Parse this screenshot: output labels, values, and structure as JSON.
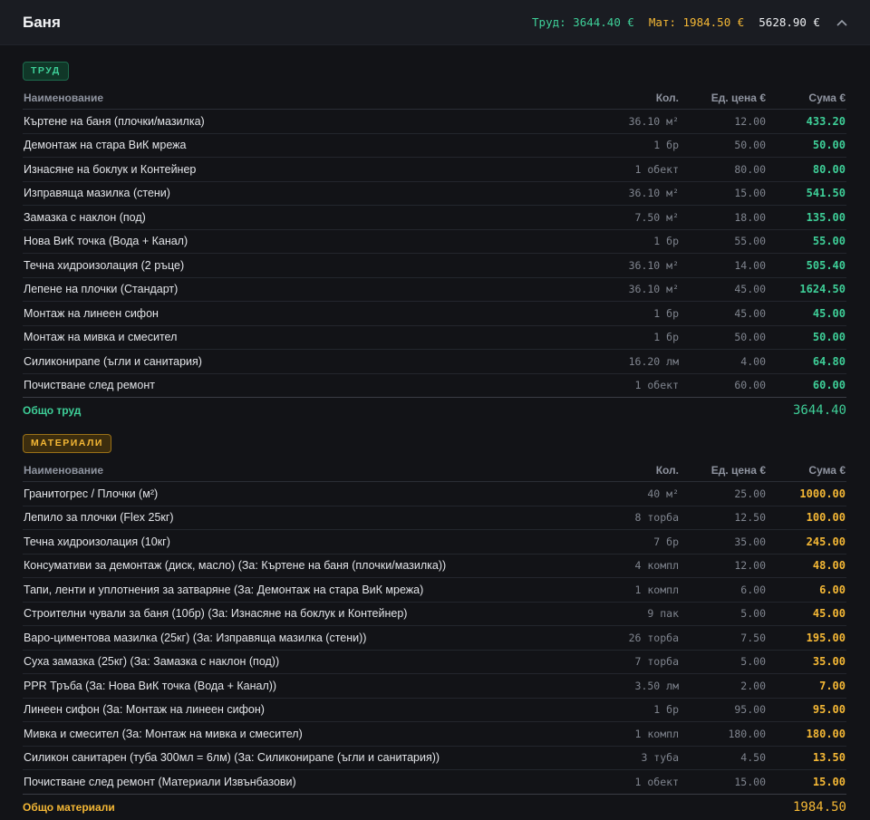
{
  "header": {
    "title": "Баня",
    "labor_total": "Труд: 3644.40 €",
    "materials_total": "Мат: 1984.50 €",
    "grand_total": "5628.90 €",
    "collapse_icon": "chevron-up-icon"
  },
  "columns": {
    "name": "Наименование",
    "qty": "Кол.",
    "unit_price": "Ед. цена €",
    "sum": "Сума €"
  },
  "labor": {
    "badge": "ТРУД",
    "rows": [
      {
        "name": "Къртене на баня (плочки/мазилка)",
        "qty": "36.10 м²",
        "unit_price": "12.00",
        "sum": "433.20"
      },
      {
        "name": "Демонтаж на стара ВиК мрежа",
        "qty": "1 бр",
        "unit_price": "50.00",
        "sum": "50.00"
      },
      {
        "name": "Изнасяне на боклук и Контейнер",
        "qty": "1 обект",
        "unit_price": "80.00",
        "sum": "80.00"
      },
      {
        "name": "Изправяща мазилка (стени)",
        "qty": "36.10 м²",
        "unit_price": "15.00",
        "sum": "541.50"
      },
      {
        "name": "Замазка с наклон (под)",
        "qty": "7.50 м²",
        "unit_price": "18.00",
        "sum": "135.00"
      },
      {
        "name": "Нова ВиК точка (Вода + Канал)",
        "qty": "1 бр",
        "unit_price": "55.00",
        "sum": "55.00"
      },
      {
        "name": "Течна хидроизолация (2 ръце)",
        "qty": "36.10 м²",
        "unit_price": "14.00",
        "sum": "505.40"
      },
      {
        "name": "Лепене на плочки (Стандарт)",
        "qty": "36.10 м²",
        "unit_price": "45.00",
        "sum": "1624.50"
      },
      {
        "name": "Монтаж на линеен сифон",
        "qty": "1 бр",
        "unit_price": "45.00",
        "sum": "45.00"
      },
      {
        "name": "Монтаж на мивка и смесител",
        "qty": "1 бр",
        "unit_price": "50.00",
        "sum": "50.00"
      },
      {
        "name": "Силиконирane (ъгли и санитария)",
        "qty": "16.20 лм",
        "unit_price": "4.00",
        "sum": "64.80"
      },
      {
        "name": "Почистване след ремонт",
        "qty": "1 обект",
        "unit_price": "60.00",
        "sum": "60.00"
      }
    ],
    "total_label": "Общо труд",
    "total_value": "3644.40"
  },
  "materials": {
    "badge": "МАТЕРИАЛИ",
    "rows": [
      {
        "name": "Гранитогрес / Плочки (м²)",
        "qty": "40 м²",
        "unit_price": "25.00",
        "sum": "1000.00"
      },
      {
        "name": "Лепило за плочки (Flex 25кг)",
        "qty": "8 торба",
        "unit_price": "12.50",
        "sum": "100.00"
      },
      {
        "name": "Течна хидроизолация (10кг)",
        "qty": "7 бр",
        "unit_price": "35.00",
        "sum": "245.00"
      },
      {
        "name": "Консумативи за демонтаж (диск, масло) (За: Къртене на баня (плочки/мазилка))",
        "qty": "4 компл",
        "unit_price": "12.00",
        "sum": "48.00"
      },
      {
        "name": "Тапи, ленти и уплотнения за затваряне (За: Демонтаж на стара ВиК мрежа)",
        "qty": "1 компл",
        "unit_price": "6.00",
        "sum": "6.00"
      },
      {
        "name": "Строителни чували за баня (10бр) (За: Изнасяне на боклук и Контейнер)",
        "qty": "9 пак",
        "unit_price": "5.00",
        "sum": "45.00"
      },
      {
        "name": "Варо-циментова мазилка (25кг) (За: Изправяща мазилка (стени))",
        "qty": "26 торба",
        "unit_price": "7.50",
        "sum": "195.00"
      },
      {
        "name": "Суха замазка (25кг) (За: Замазка с наклон (под))",
        "qty": "7 торба",
        "unit_price": "5.00",
        "sum": "35.00"
      },
      {
        "name": "PPR Тръба (За: Нова ВиК точка (Вода + Канал))",
        "qty": "3.50 лм",
        "unit_price": "2.00",
        "sum": "7.00"
      },
      {
        "name": "Линеен сифон (За: Монтаж на линеен сифон)",
        "qty": "1 бр",
        "unit_price": "95.00",
        "sum": "95.00"
      },
      {
        "name": "Мивка и смесител (За: Монтаж на мивка и смесител)",
        "qty": "1 компл",
        "unit_price": "180.00",
        "sum": "180.00"
      },
      {
        "name": "Силикон санитарен (туба 300мл = 6лм) (За: Силиконирane (ъгли и санитария))",
        "qty": "3 туба",
        "unit_price": "4.50",
        "sum": "13.50"
      },
      {
        "name": "Почистване след ремонт (Материали Извънбазови)",
        "qty": "1 обект",
        "unit_price": "15.00",
        "sum": "15.00"
      }
    ],
    "total_label": "Общо материали",
    "total_value": "1984.50"
  },
  "colors": {
    "labor_accent": "#3ecf98",
    "materials_accent": "#f5b835",
    "background": "#121317"
  }
}
